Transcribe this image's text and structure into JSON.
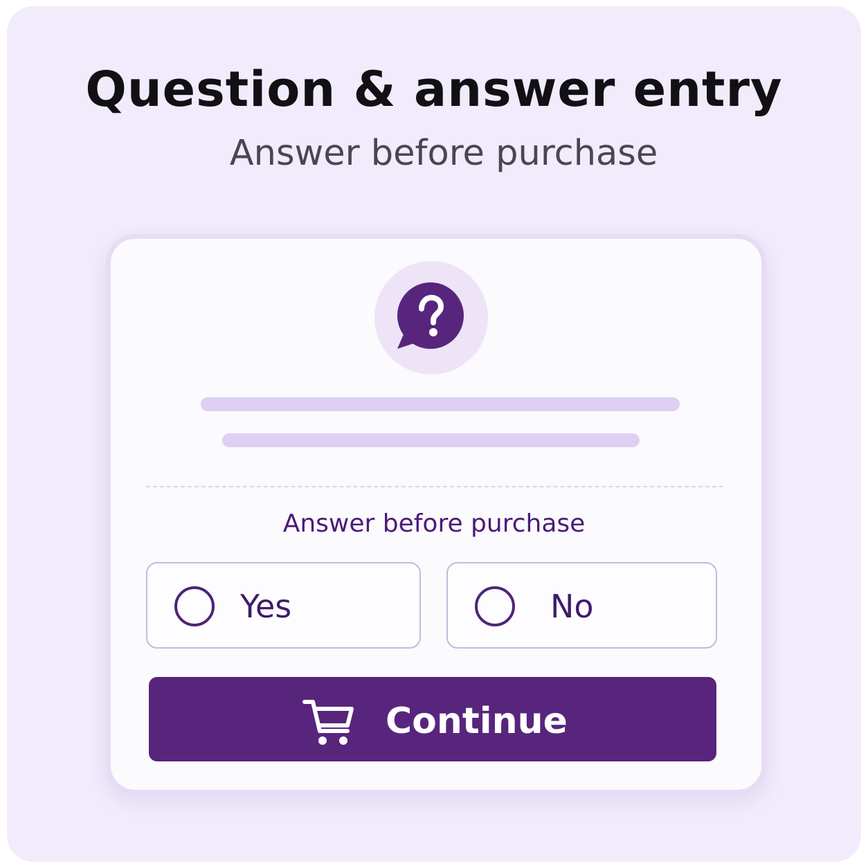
{
  "header": {
    "title": "Question & answer entry",
    "subtitle": "Answer before purchase"
  },
  "card": {
    "icon": "question-bubble-icon",
    "prompt": "Answer before purchase",
    "options": [
      {
        "label": "Yes",
        "selected": false
      },
      {
        "label": "No",
        "selected": false
      }
    ],
    "continue_label": "Continue",
    "continue_icon": "cart-icon"
  },
  "colors": {
    "background": "#f1ebfb",
    "card": "#fbfafc",
    "accent": "#58257d",
    "placeholder_line": "#ddd0f2"
  }
}
